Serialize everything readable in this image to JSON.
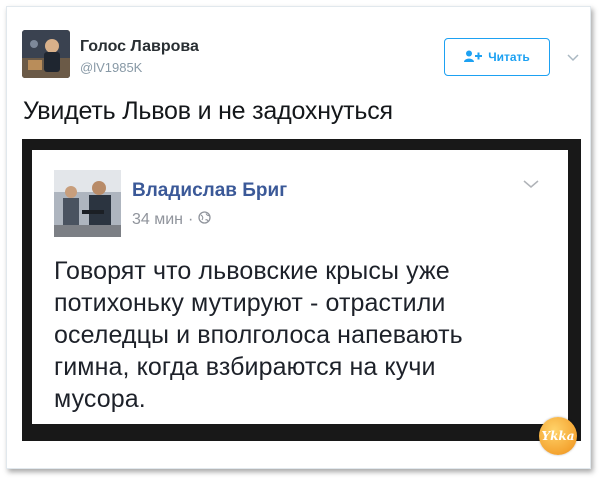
{
  "tweet": {
    "author_name": "Голос Лаврова",
    "author_handle": "@lV1985K",
    "follow_label": "Читать",
    "text": "Увидеть Львов и не задохнуться"
  },
  "embedded_post": {
    "author_name": "Владислав Бриг",
    "time": "34 мин",
    "separator": "·",
    "text_lines": [
      "Говорят что львовские крысы уже",
      "потихоньку мутируют - отрастили",
      "оселедцы и вполголоса напевають",
      "гимна, когда взбираются на кучи",
      "мусора."
    ]
  },
  "watermark": {
    "text": "Ykka"
  },
  "colors": {
    "twitter_blue": "#1da1f2",
    "fb_blue": "#3b5998",
    "frame": "#181818"
  }
}
